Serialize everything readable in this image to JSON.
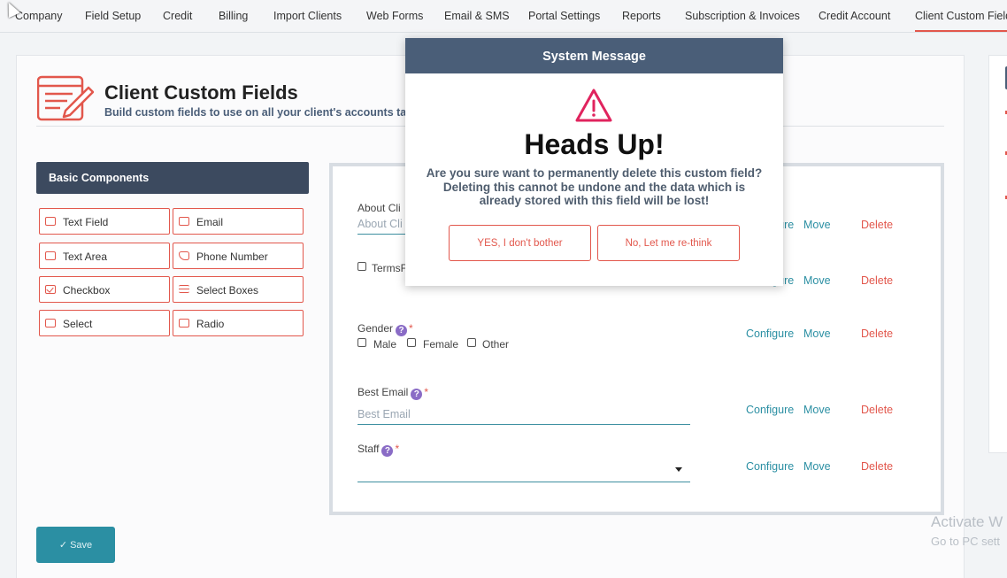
{
  "nav": {
    "tabs": [
      "Company",
      "Field Setup",
      "Credit",
      "Billing",
      "Import Clients",
      "Web Forms",
      "Email & SMS",
      "Portal Settings",
      "Reports",
      "Subscription & Invoices",
      "Credit Account",
      "Client Custom Fields"
    ],
    "active": "Client Custom Fields"
  },
  "page": {
    "title": "Client Custom Fields",
    "subtitle": "Build custom fields to use on all your client's accounts tab"
  },
  "components": {
    "header": "Basic Components",
    "items": [
      {
        "label": "Text Field",
        "icon": "text-field-icon"
      },
      {
        "label": "Email",
        "icon": "email-icon"
      },
      {
        "label": "Text Area",
        "icon": "text-area-icon"
      },
      {
        "label": "Phone Number",
        "icon": "phone-icon"
      },
      {
        "label": "Checkbox",
        "icon": "checkbox-icon"
      },
      {
        "label": "Select Boxes",
        "icon": "list-icon"
      },
      {
        "label": "Select",
        "icon": "select-icon"
      },
      {
        "label": "Radio",
        "icon": "radio-icon"
      }
    ]
  },
  "form": {
    "about": {
      "label": "About Cli",
      "placeholder": "About Cli"
    },
    "terms": {
      "label": "TermsF"
    },
    "gender": {
      "label": "Gender",
      "options": [
        "Male",
        "Female",
        "Other"
      ]
    },
    "best_email": {
      "label": "Best Email",
      "placeholder": "Best Email"
    },
    "staff": {
      "label": "Staff"
    },
    "actions": {
      "configure": "Configure",
      "move": "Move",
      "delete": "Delete"
    },
    "required_mark": "*",
    "help_mark": "?"
  },
  "save_label": "✓ Save",
  "watermark": {
    "line1": "Activate W",
    "line2": "Go to PC sett"
  },
  "modal": {
    "header": "System Message",
    "title": "Heads Up!",
    "message_lines": [
      "Are you sure want to permanently delete this custom field?",
      "Deleting this cannot be undone and the data which is",
      "already stored with this field will be lost!"
    ],
    "confirm": "YES, I don't bother",
    "cancel": "No, Let me re-think"
  },
  "colors": {
    "accent": "#e2574c",
    "teal": "#2b8fa3",
    "header": "#4a5e78"
  }
}
